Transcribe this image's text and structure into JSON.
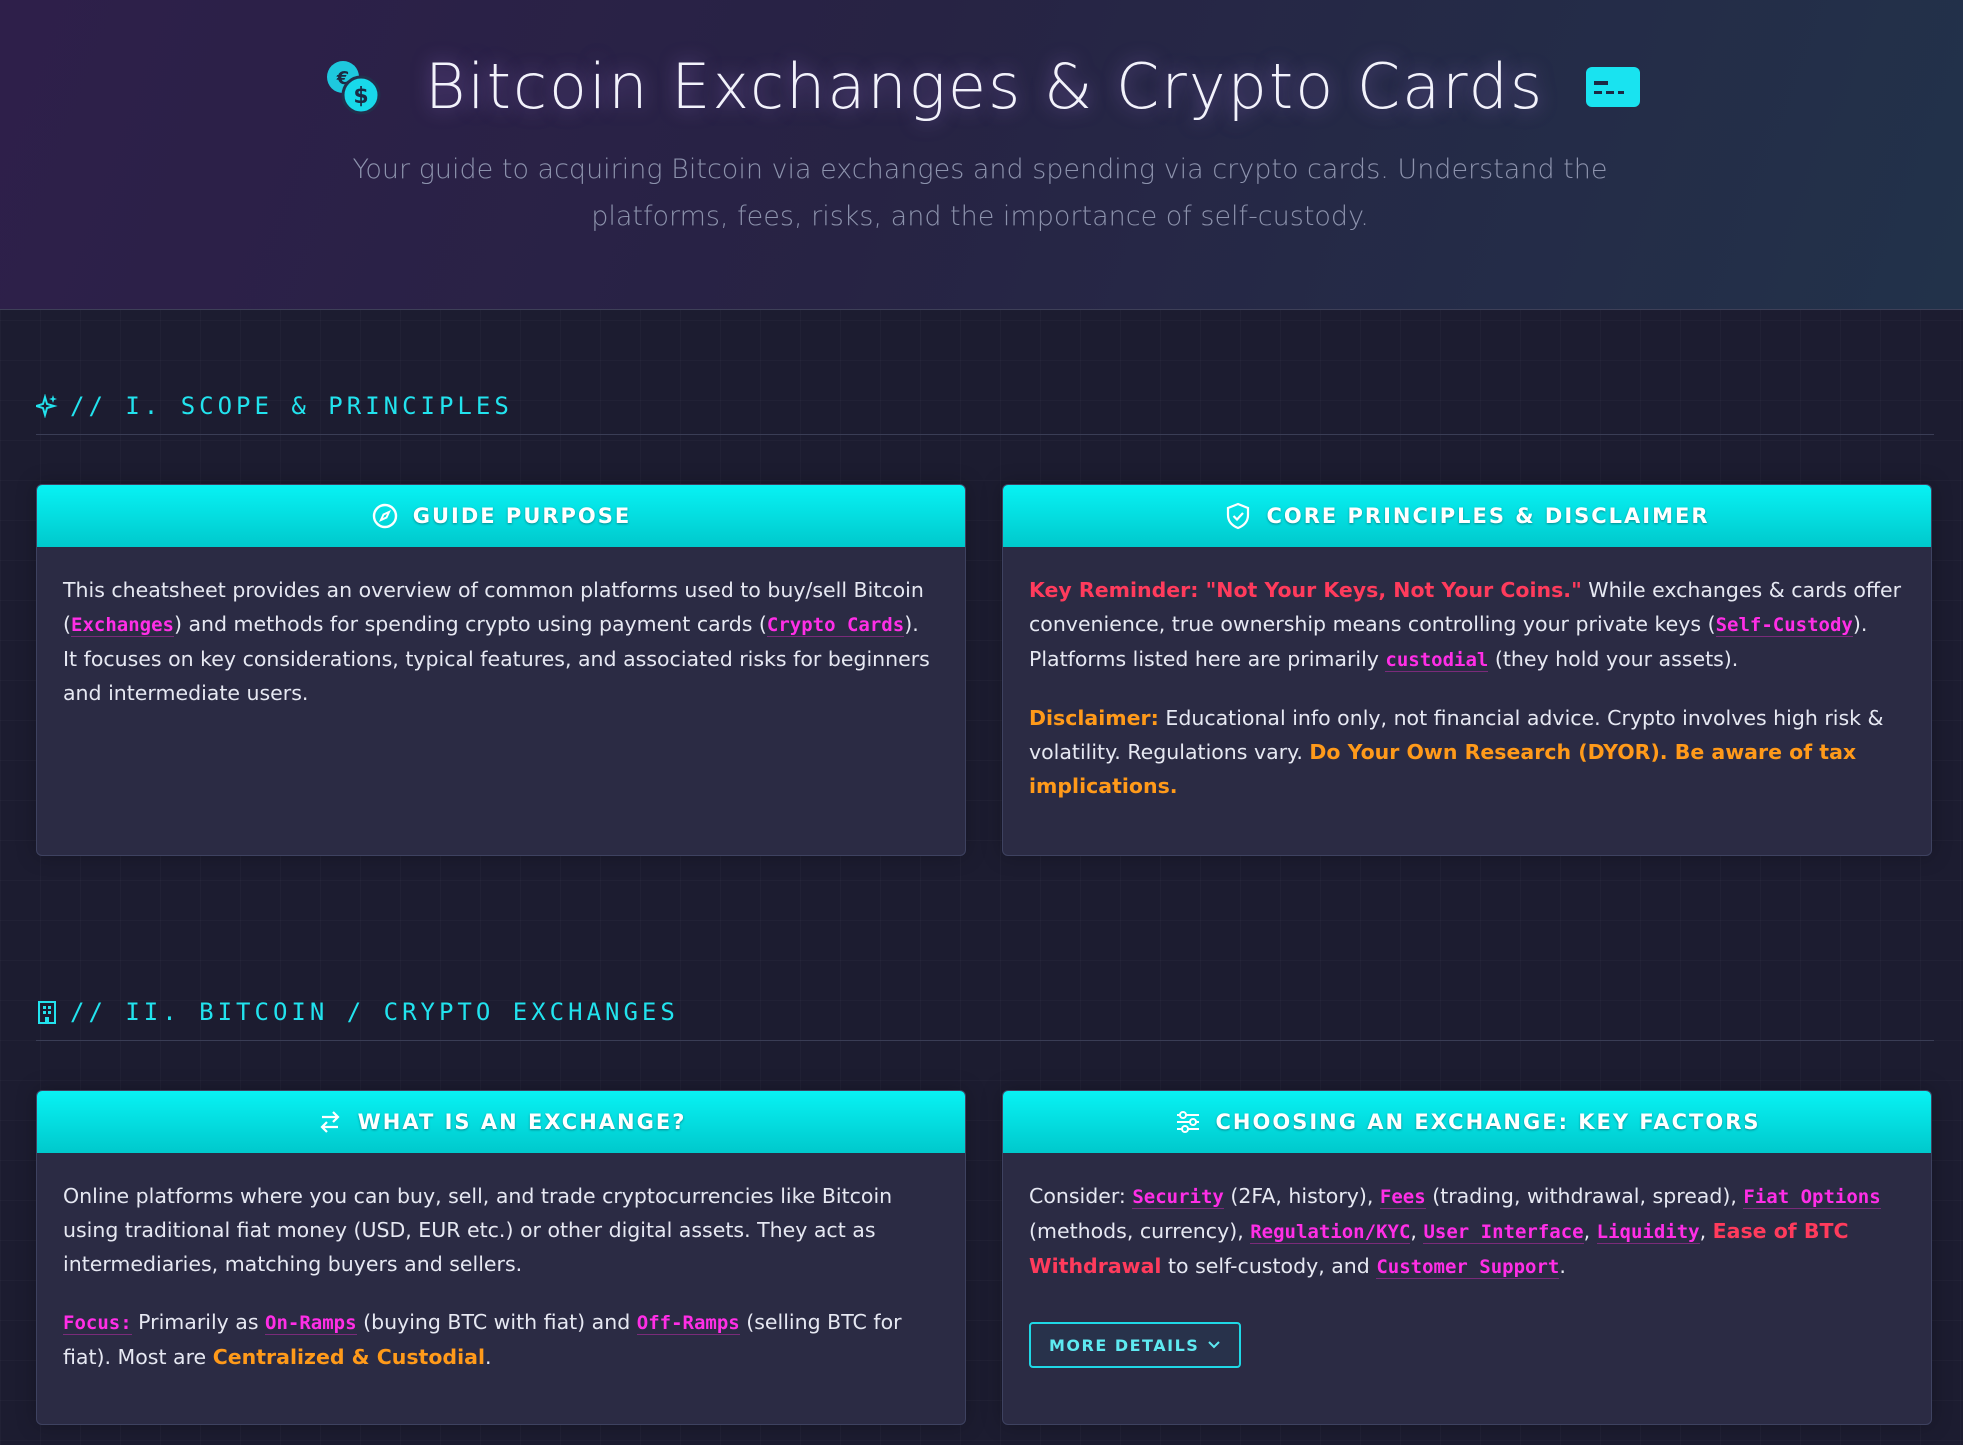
{
  "header": {
    "title": "Bitcoin Exchanges & Crypto Cards",
    "subtitle": "Your guide to acquiring Bitcoin via exchanges and spending via crypto cards. Understand the platforms, fees, risks, and the importance of self-custody.",
    "left_icon": "coins-icon",
    "right_icon": "credit-card-icon"
  },
  "sections": [
    {
      "title": "// I. SCOPE & PRINCIPLES",
      "icon": "sparkles-icon"
    },
    {
      "title": "// II. BITCOIN / CRYPTO EXCHANGES",
      "icon": "building-icon"
    }
  ],
  "cards": {
    "guide_purpose": {
      "title": "Guide Purpose",
      "icon": "compass-icon",
      "p1": {
        "t1": "This cheatsheet provides an overview of common platforms used to buy/sell Bitcoin (",
        "tag1": "Exchanges",
        "t2": ") and methods for spending crypto using payment cards (",
        "tag2": "Crypto Cards",
        "t3": "). It focuses on key considerations, typical features, and associated risks for beginners and intermediate users."
      }
    },
    "core_principles": {
      "title": "Core Principles & Disclaimer",
      "icon": "shield-check-icon",
      "p1": {
        "red": "Key Reminder: \"Not Your Keys, Not Your Coins.\"",
        "t1": " While exchanges & cards offer convenience, true ownership means controlling your private keys (",
        "tag1": "Self-Custody",
        "t2": "). Platforms listed here are primarily ",
        "tag2": "custodial",
        "t3": " (they hold your assets)."
      },
      "p2": {
        "orange1": "Disclaimer:",
        "t1": " Educational info only, not financial advice. Crypto involves high risk & volatility. Regulations vary. ",
        "orange2": "Do Your Own Research (DYOR). Be aware of tax implications."
      }
    },
    "what_is_exchange": {
      "title": "What is an Exchange?",
      "icon": "arrows-exchange-icon",
      "p1": "Online platforms where you can buy, sell, and trade cryptocurrencies like Bitcoin using traditional fiat money (USD, EUR etc.) or other digital assets. They act as intermediaries, matching buyers and sellers.",
      "p2": {
        "tag1": "Focus:",
        "t1": " Primarily as ",
        "tag2": "On-Ramps",
        "t2": " (buying BTC with fiat) and ",
        "tag3": "Off-Ramps",
        "t3": " (selling BTC for fiat). Most are ",
        "orange": "Centralized & Custodial",
        "t4": "."
      }
    },
    "choosing_exchange": {
      "title": "Choosing an Exchange: Key Factors",
      "icon": "sliders-icon",
      "p1": {
        "t0": "Consider: ",
        "tag1": "Security",
        "t1": " (2FA, history), ",
        "tag2": "Fees",
        "t2": " (trading, withdrawal, spread), ",
        "tag3": "Fiat Options",
        "t3": " (methods, currency), ",
        "tag4": "Regulation/KYC",
        "t4": ", ",
        "tag5": "User Interface",
        "t5": ", ",
        "tag6": "Liquidity",
        "t6": ", ",
        "red": "Ease of BTC Withdrawal",
        "t7": " to self-custody, and ",
        "tag7": "Customer Support",
        "t8": "."
      },
      "button": "MORE DETAILS"
    }
  },
  "colors": {
    "accent_cyan": "#08f2f4",
    "tag_magenta": "#ff2ee6",
    "warning_red": "#ff3b5c",
    "warning_orange": "#ff9a1a",
    "background": "#1c1c30"
  }
}
